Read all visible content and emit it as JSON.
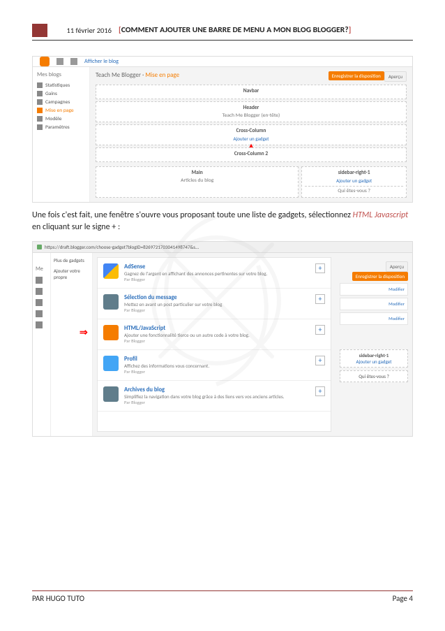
{
  "header": {
    "date": "11 février 2016",
    "title_bracket_open": "[",
    "title_text": "COMMENT AJOUTER UNE BARRE DE MENU A MON BLOG BLOGGER?",
    "title_bracket_close": "]"
  },
  "shot1": {
    "toolbar_view": "Afficher le blog",
    "sidebar_title": "Mes blogs",
    "sidebar": [
      {
        "label": "Statistiques",
        "active": false
      },
      {
        "label": "Gains",
        "active": false
      },
      {
        "label": "Campagnes",
        "active": false
      },
      {
        "label": "Mise en page",
        "active": true
      },
      {
        "label": "Modèle",
        "active": false
      },
      {
        "label": "Paramètres",
        "active": false
      }
    ],
    "breadcrumb_blog": "Teach Me Blogger",
    "breadcrumb_sep": "·",
    "breadcrumb_page": "Mise en page",
    "btn_save": "Enregistrer la disposition",
    "btn_preview": "Aperçu",
    "boxes": {
      "navbar": "Navbar",
      "header": "Header",
      "header_sub": "Teach Me Blogger (en-tête)",
      "cross1": "Cross-Column",
      "add_gadget": "Ajouter un gadget",
      "cross2": "Cross-Column 2",
      "main": "Main",
      "main_sub": "Articles du blog",
      "sidebar_r": "sidebar-right-1",
      "who": "Qui êtes-vous ?"
    }
  },
  "paragraph": {
    "pre": "Une fois c'est fait, une fenêtre s'ouvre vous proposant toute une liste de gadgets, sélectionnez ",
    "italic": "HTML Javascript",
    "post": " en cliquant sur le signe + :"
  },
  "shot2": {
    "url": "https://draft.blogger.com/choose-gadget?blogID=8269721703041498747&s...",
    "side_label_me": "Me",
    "panel_label1": "Plus de gadgets",
    "panel_label2": "Ajouter votre propre",
    "gadgets": [
      {
        "title": "AdSense",
        "desc": "Gagnez de l'argent en affichant des annonces pertinentes sur votre blog.",
        "by": "Par Blogger",
        "ic": "ic-adsense"
      },
      {
        "title": "Sélection du message",
        "desc": "Mettez en avant un post particulier sur votre blog",
        "by": "Par Blogger",
        "ic": "ic-select"
      },
      {
        "title": "HTML/JavaScript",
        "desc": "Ajouter une fonctionnalité tierce ou un autre code à votre blog.",
        "by": "Par Blogger",
        "ic": "ic-html"
      },
      {
        "title": "Profil",
        "desc": "Affichez des informations vous concernant.",
        "by": "Par Blogger",
        "ic": "ic-profil"
      },
      {
        "title": "Archives du blog",
        "desc": "Simplifiez la navigation dans votre blog grâce à des liens vers vos anciens articles.",
        "by": "Par Blogger",
        "ic": "ic-archive"
      }
    ],
    "right_modify": "Modifier",
    "right_sidebar": "sidebar-right-1",
    "right_add": "Ajouter un gadget",
    "right_who": "Qui êtes-vous ?"
  },
  "footer": {
    "author": "PAR HUGO TUTO",
    "page": "Page 4"
  }
}
